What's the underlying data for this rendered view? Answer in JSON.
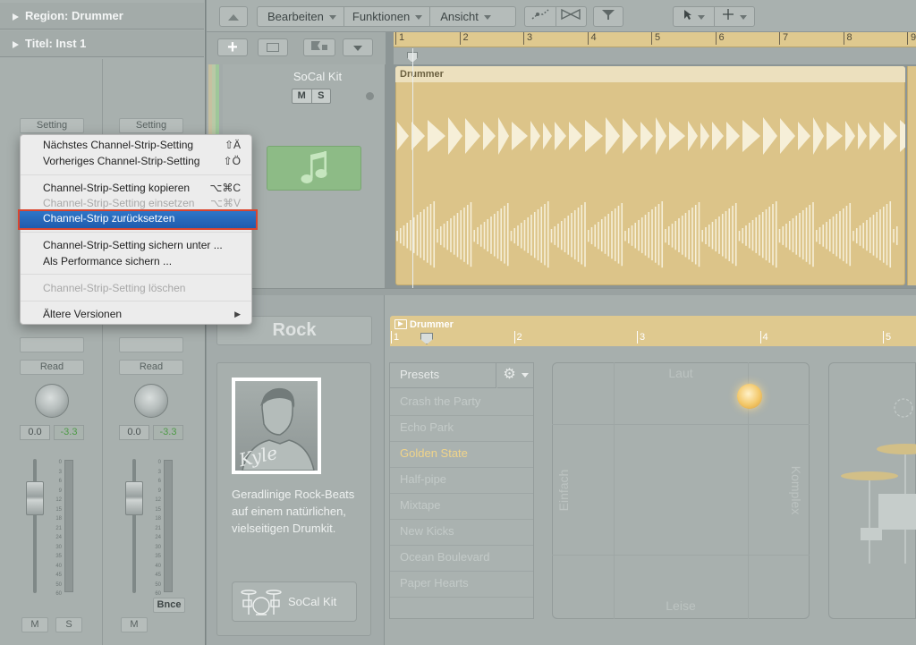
{
  "inspector": {
    "region_label": "Region:  Drummer",
    "title_label": "Titel: Inst 1",
    "strips": [
      {
        "setting": "Setting",
        "read": "Read",
        "pan_value": "0.0",
        "gain_value": "-3.3",
        "mute": "M",
        "solo": "S"
      },
      {
        "setting": "Setting",
        "read": "Read",
        "pan_value": "0.0",
        "gain_value": "-3.3",
        "mute": "M",
        "bounce": "Bnce"
      }
    ],
    "meter_scale": [
      "0",
      "3",
      "6",
      "9",
      "12",
      "15",
      "18",
      "21",
      "24",
      "30",
      "35",
      "40",
      "45",
      "50",
      "60"
    ]
  },
  "toolbar": {
    "edit": "Bearbeiten",
    "functions": "Funktionen",
    "view": "Ansicht"
  },
  "ruler": {
    "bars": [
      "1",
      "2",
      "3",
      "4",
      "5",
      "6",
      "7",
      "8",
      "9"
    ]
  },
  "track": {
    "name": "SoCal Kit",
    "mute": "M",
    "solo": "S",
    "region_name": "Drummer"
  },
  "context_menu": {
    "items": [
      {
        "label": "Nächstes Channel-Strip-Setting",
        "shortcut": "⇧Ä",
        "disabled": false
      },
      {
        "label": "Vorheriges Channel-Strip-Setting",
        "shortcut": "⇧Ö",
        "disabled": false
      },
      {
        "label": "Channel-Strip-Setting kopieren",
        "shortcut": "⌥⌘C",
        "disabled": false
      },
      {
        "label": "Channel-Strip-Setting einsetzen",
        "shortcut": "⌥⌘V",
        "disabled": true
      },
      {
        "label": "Channel-Strip zurücksetzen",
        "shortcut": "",
        "disabled": false,
        "highlighted": true
      },
      {
        "label": "Channel-Strip-Setting sichern unter ...",
        "shortcut": "",
        "disabled": false
      },
      {
        "label": "Als Performance sichern ...",
        "shortcut": "",
        "disabled": false
      },
      {
        "label": "Channel-Strip-Setting löschen",
        "shortcut": "",
        "disabled": true
      },
      {
        "label": "Ältere Versionen",
        "shortcut": "▶",
        "disabled": false
      }
    ]
  },
  "drummer": {
    "genre": "Rock",
    "avatar_signature": "Kyle",
    "description": "Geradlinige Rock-Beats auf einem natürlichen, vielseitigen Drumkit.",
    "kit_button": "SoCal Kit",
    "editor_title": "Drummer",
    "editor_ruler": [
      "1",
      "2",
      "3",
      "4",
      "5"
    ],
    "presets_label": "Presets",
    "presets": [
      "Crash the Party",
      "Echo Park",
      "Golden State",
      "Half-pipe",
      "Mixtape",
      "New Kicks",
      "Ocean Boulevard",
      "Paper Hearts"
    ],
    "selected_preset": "Golden State",
    "xy": {
      "top": "Laut",
      "bottom": "Leise",
      "left": "Einfach",
      "right": "Komplex"
    }
  },
  "colors": {
    "region": "#dcc489",
    "highlight": "#1f5cae",
    "callout": "#d9452f",
    "selected_preset": "#f0d48a"
  }
}
